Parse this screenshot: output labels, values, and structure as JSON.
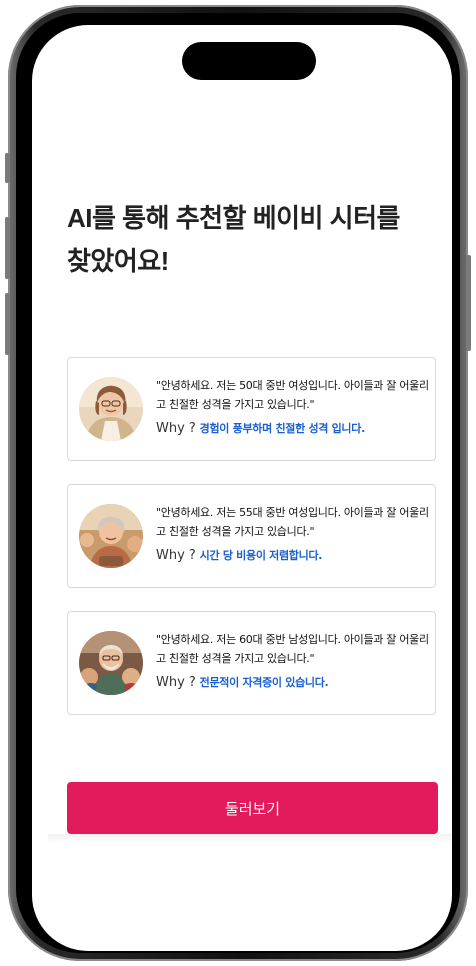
{
  "headline": "AI를 통해 추천할 베이비 시터를 찾았어요!",
  "why_label": "Why ?",
  "cards": [
    {
      "quote": "\"안녕하세요. 저는 50대 중반 여성입니다. 아이들과 잘 어울리고 친절한 성격을 가지고 있습니다.\"",
      "reason": "경험이 풍부하며 친절한 성격 입니다."
    },
    {
      "quote": "\"안녕하세요. 저는 55대 중반 여성입니다. 아이들과 잘 어울리고 친절한 성격을 가지고 있습니다.\"",
      "reason": "시간 당 비용이 저렴합니다."
    },
    {
      "quote": "\"안녕하세요. 저는 60대 중반 남성입니다. 아이들과 잘 어울리고 친절한 성격을 가지고 있습니다.\"",
      "reason": "전문적이 자격증이 있습니다."
    }
  ],
  "browse_button": "둘러보기",
  "colors": {
    "accent": "#e31a5c",
    "reason_text": "#1a5fd1"
  }
}
